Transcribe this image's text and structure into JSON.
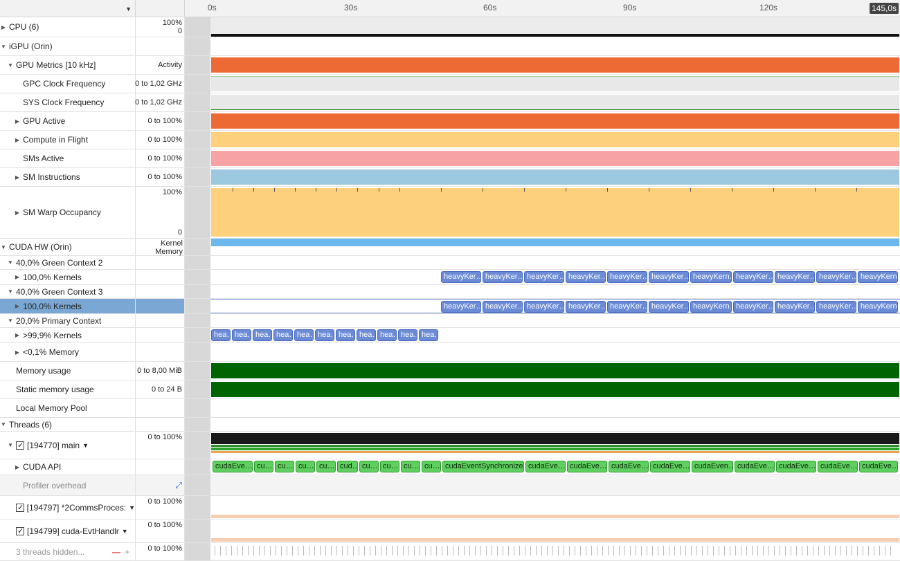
{
  "timeline": {
    "ticks": [
      "0s",
      "30s",
      "60s",
      "90s",
      "120s"
    ],
    "end_badge": "145,0s"
  },
  "rows": {
    "cpu": {
      "label": "CPU (6)",
      "range_top": "100%",
      "range_bottom": "0"
    },
    "igpu": {
      "label": "iGPU (Orin)"
    },
    "gpu_metrics": {
      "label": "GPU Metrics [10 kHz]",
      "range": "Activity"
    },
    "gpc_clock": {
      "label": "GPC Clock Frequency",
      "range": "0 to 1,02 GHz"
    },
    "sys_clock": {
      "label": "SYS Clock Frequency",
      "range": "0 to 1,02 GHz"
    },
    "gpu_active": {
      "label": "GPU Active",
      "range": "0 to 100%"
    },
    "compute_flight": {
      "label": "Compute in Flight",
      "range": "0 to 100%"
    },
    "sms_active": {
      "label": "SMs Active",
      "range": "0 to 100%"
    },
    "sm_instr": {
      "label": "SM Instructions",
      "range": "0 to 100%"
    },
    "sm_warp": {
      "label": "SM Warp Occupancy",
      "range_top": "100%",
      "range_bottom": "0"
    },
    "cuda_hw": {
      "label": "CUDA HW (Orin)",
      "range_line1": "Kernel",
      "range_line2": "Memory"
    },
    "gc2": {
      "label": "40,0% Green Context 2"
    },
    "gc2_kernels": {
      "label": "100,0% Kernels"
    },
    "gc3": {
      "label": "40,0% Green Context 3"
    },
    "gc3_kernels": {
      "label": "100,0% Kernels"
    },
    "primary": {
      "label": "20,0% Primary Context"
    },
    "primary_kernels": {
      "label": ">99,9% Kernels"
    },
    "primary_memory": {
      "label": "<0,1% Memory"
    },
    "mem_usage": {
      "label": "Memory usage",
      "range": "0 to 8,00 MiB"
    },
    "static_mem": {
      "label": "Static memory usage",
      "range": "0 to 24 B"
    },
    "local_pool": {
      "label": "Local Memory Pool"
    },
    "threads": {
      "label": "Threads (6)"
    },
    "main": {
      "label": "[194770] main",
      "range": "0 to 100%"
    },
    "cuda_api": {
      "label": "CUDA API"
    },
    "profiler": {
      "label": "Profiler overhead"
    },
    "comms": {
      "label": "[194797] *2CommsProces:",
      "range": "0 to 100%"
    },
    "evt": {
      "label": "[194799] cuda-EvtHandlr",
      "range": "0 to 100%"
    },
    "hidden": {
      "label": "3 threads hidden...",
      "range": "0 to 100%"
    }
  },
  "kernels_green": [
    "heavyKer…",
    "heavyKer…",
    "heavyKer…",
    "heavyKer…",
    "heavyKer…",
    "heavyKer…",
    "heavyKern…",
    "heavyKer…",
    "heavyKer…",
    "heavyKer…",
    "heavyKern…"
  ],
  "kernels_primary": [
    "hea…",
    "hea…",
    "hea…",
    "hea…",
    "hea…",
    "hea…",
    "hea…",
    "hea…",
    "hea…",
    "hea…",
    "hea…"
  ],
  "api_calls": [
    "cudaEve…",
    "cu…",
    "cu…",
    "cu…",
    "cu…",
    "cud…",
    "cu…",
    "cu…",
    "cu…",
    "cu…",
    "cudaEventSynchronize",
    "cudaEve…",
    "cudaEve…",
    "cudaEve…",
    "cudaEve…",
    "cudaEven…",
    "cudaEve…",
    "cudaEve…",
    "cudaEve…",
    "cudaEve…"
  ],
  "colors": {
    "gpu_metrics": "#ee6a35",
    "compute": "#fdd17c",
    "sms": "#f7a3a3",
    "sm_instr": "#9cc8e0",
    "cuda_hw": "#6cb8ee",
    "memory": "#006400",
    "kernel": "#6b8bd6",
    "api": "#5fd05f"
  }
}
